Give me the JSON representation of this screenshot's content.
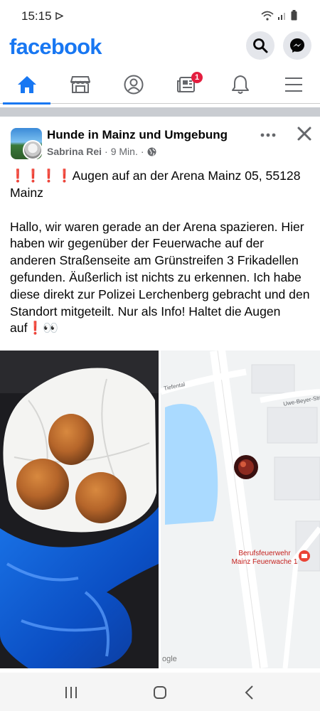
{
  "status_bar": {
    "time": "15:15"
  },
  "header": {
    "logo": "facebook",
    "search_icon": "search-icon",
    "messenger_icon": "messenger-icon"
  },
  "tabs": [
    {
      "name": "home",
      "icon": "home-icon",
      "active": true
    },
    {
      "name": "marketplace",
      "icon": "store-icon"
    },
    {
      "name": "profile",
      "icon": "profile-icon"
    },
    {
      "name": "news",
      "icon": "news-icon",
      "badge": "1"
    },
    {
      "name": "notifications",
      "icon": "bell-icon"
    },
    {
      "name": "menu",
      "icon": "menu-icon"
    }
  ],
  "post": {
    "group_name": "Hunde in Mainz und Umgebung",
    "author": "Sabrina Rei",
    "time": "9 Min.",
    "title_emoji": "❗❗❗❗",
    "title": "Augen auf an der Arena Mainz 05, 55128 Mainz",
    "body": "Hallo,  wir waren gerade an der Arena spazieren. Hier haben wir gegenüber der Feuerwache auf der anderen Straßenseite am Grünstreifen 3 Frikadellen gefunden.  Äußerlich ist nichts zu erkennen.  Ich habe diese direkt zur Polizei Lerchenberg gebracht und den Standort mitgeteilt.  Nur als Info! Haltet die Augen auf",
    "body_end_emoji": "❗👀"
  },
  "map": {
    "street_1": "Tiefental",
    "street_2": "Uwe-Beyer-Stra",
    "poi_line_1": "Berufsfeuerwehr",
    "poi_line_2": "Mainz Feuerwache 1",
    "attribution": "ogle"
  },
  "colors": {
    "brand": "#1877f2",
    "badge": "#e41e3f",
    "water": "#aadaff"
  }
}
